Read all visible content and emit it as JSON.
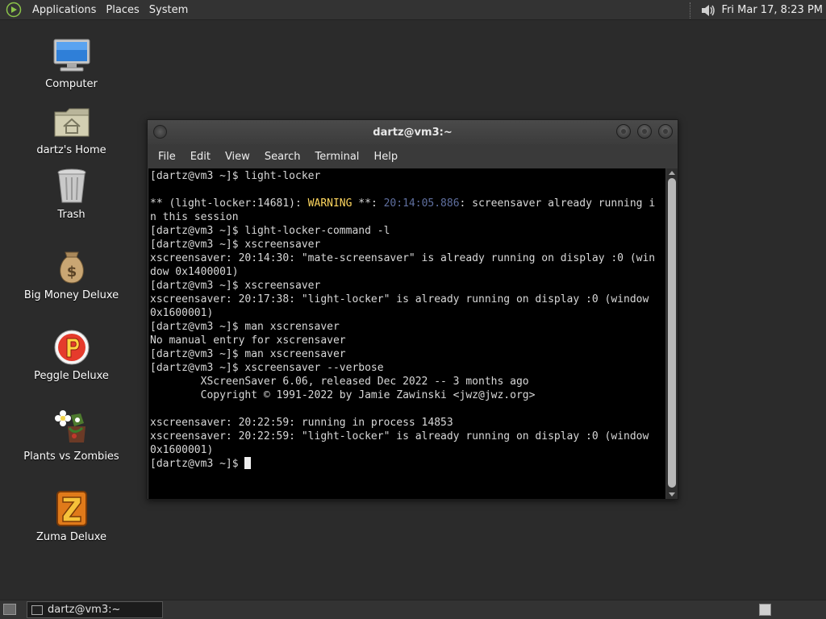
{
  "top_panel": {
    "menus": [
      "Applications",
      "Places",
      "System"
    ],
    "clock": "Fri Mar 17,  8:23 PM"
  },
  "desktop_icons": [
    {
      "label": "Computer",
      "icon": "computer-icon"
    },
    {
      "label": "dartz's Home",
      "icon": "home-folder-icon"
    },
    {
      "label": "Trash",
      "icon": "trash-icon"
    },
    {
      "label": "Big Money Deluxe",
      "icon": "money-bag-icon"
    },
    {
      "label": "Peggle Deluxe",
      "icon": "peggle-icon"
    },
    {
      "label": "Plants vs Zombies",
      "icon": "plants-vs-zombies-icon"
    },
    {
      "label": "Zuma Deluxe",
      "icon": "zuma-icon"
    }
  ],
  "window": {
    "title": "dartz@vm3:~",
    "menu": [
      "File",
      "Edit",
      "View",
      "Search",
      "Terminal",
      "Help"
    ]
  },
  "terminal": {
    "lines": [
      "[dartz@vm3 ~]$ light-locker",
      "",
      "** (light-locker:14681): WARNING **: 20:14:05.886: screensaver already running i",
      "n this session",
      "[dartz@vm3 ~]$ light-locker-command -l",
      "[dartz@vm3 ~]$ xscreensaver",
      "xscreensaver: 20:14:30: \"mate-screensaver\" is already running on display :0 (win",
      "dow 0x1400001)",
      "[dartz@vm3 ~]$ xscreensaver",
      "xscreensaver: 20:17:38: \"light-locker\" is already running on display :0 (window",
      "0x1600001)",
      "[dartz@vm3 ~]$ man xscrensaver",
      "No manual entry for xscrensaver",
      "[dartz@vm3 ~]$ man xscreensaver",
      "[dartz@vm3 ~]$ xscreensaver --verbose",
      "        XScreenSaver 6.06, released Dec 2022 -- 3 months ago",
      "        Copyright © 1991-2022 by Jamie Zawinski <jwz@jwz.org>",
      "",
      "xscreensaver: 20:22:59: running in process 14853",
      "xscreensaver: 20:22:59: \"light-locker\" is already running on display :0 (window",
      "0x1600001)",
      "[dartz@vm3 ~]$ "
    ],
    "warning_line": {
      "prefix": "** (light-locker:14681): ",
      "warning": "WARNING",
      "mid": " **: ",
      "time": "20:14:05.886",
      "suffix": ": screensaver already running i"
    },
    "colors": {
      "background": "#000000",
      "text": "#d8d8d8",
      "warning": "#ffd75f",
      "timestamp": "#5f6f9f"
    }
  },
  "bottom_panel": {
    "task_label": "dartz@vm3:~"
  }
}
